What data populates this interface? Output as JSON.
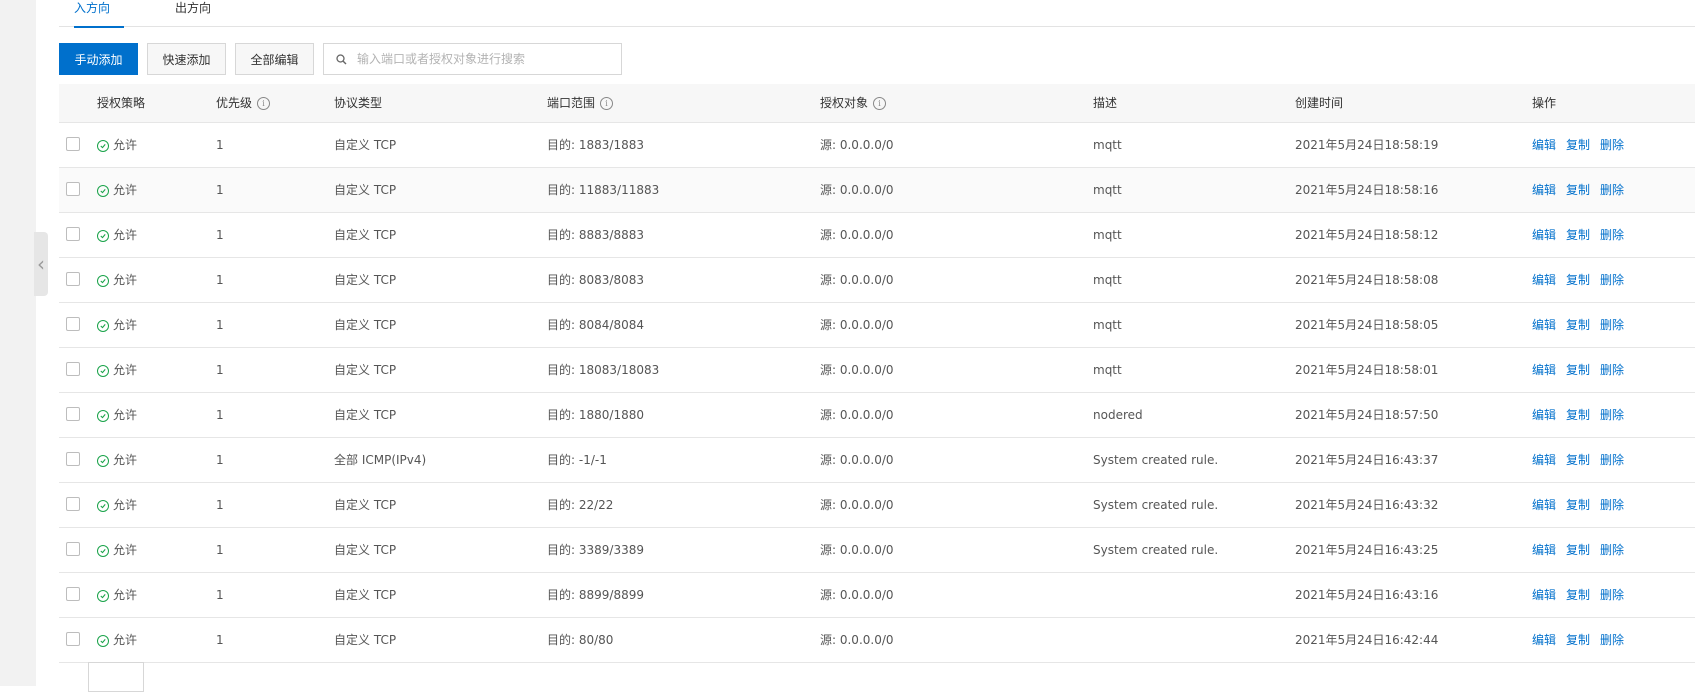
{
  "tabs": [
    {
      "label": "入方向",
      "active": true
    },
    {
      "label": "出方向",
      "active": false
    }
  ],
  "toolbar": {
    "manual_add": "手动添加",
    "quick_add": "快速添加",
    "edit_all": "全部编辑",
    "search_placeholder": "输入端口或者授权对象进行搜索"
  },
  "columns": {
    "policy": "授权策略",
    "priority": "优先级",
    "protocol": "协议类型",
    "port_range": "端口范围",
    "auth_object": "授权对象",
    "description": "描述",
    "created": "创建时间",
    "actions": "操作"
  },
  "actions": {
    "edit": "编辑",
    "copy": "复制",
    "delete": "删除"
  },
  "rows": [
    {
      "policy": "允许",
      "priority": "1",
      "protocol": "自定义 TCP",
      "port": "目的: 1883/1883",
      "source": "源: 0.0.0.0/0",
      "desc": "mqtt",
      "created": "2021年5月24日18:58:19"
    },
    {
      "policy": "允许",
      "priority": "1",
      "protocol": "自定义 TCP",
      "port": "目的: 11883/11883",
      "source": "源: 0.0.0.0/0",
      "desc": "mqtt",
      "created": "2021年5月24日18:58:16"
    },
    {
      "policy": "允许",
      "priority": "1",
      "protocol": "自定义 TCP",
      "port": "目的: 8883/8883",
      "source": "源: 0.0.0.0/0",
      "desc": "mqtt",
      "created": "2021年5月24日18:58:12"
    },
    {
      "policy": "允许",
      "priority": "1",
      "protocol": "自定义 TCP",
      "port": "目的: 8083/8083",
      "source": "源: 0.0.0.0/0",
      "desc": "mqtt",
      "created": "2021年5月24日18:58:08"
    },
    {
      "policy": "允许",
      "priority": "1",
      "protocol": "自定义 TCP",
      "port": "目的: 8084/8084",
      "source": "源: 0.0.0.0/0",
      "desc": "mqtt",
      "created": "2021年5月24日18:58:05"
    },
    {
      "policy": "允许",
      "priority": "1",
      "protocol": "自定义 TCP",
      "port": "目的: 18083/18083",
      "source": "源: 0.0.0.0/0",
      "desc": "mqtt",
      "created": "2021年5月24日18:58:01"
    },
    {
      "policy": "允许",
      "priority": "1",
      "protocol": "自定义 TCP",
      "port": "目的: 1880/1880",
      "source": "源: 0.0.0.0/0",
      "desc": "nodered",
      "created": "2021年5月24日18:57:50"
    },
    {
      "policy": "允许",
      "priority": "1",
      "protocol": "全部 ICMP(IPv4)",
      "port": "目的: -1/-1",
      "source": "源: 0.0.0.0/0",
      "desc": "System created rule.",
      "created": "2021年5月24日16:43:37"
    },
    {
      "policy": "允许",
      "priority": "1",
      "protocol": "自定义 TCP",
      "port": "目的: 22/22",
      "source": "源: 0.0.0.0/0",
      "desc": "System created rule.",
      "created": "2021年5月24日16:43:32"
    },
    {
      "policy": "允许",
      "priority": "1",
      "protocol": "自定义 TCP",
      "port": "目的: 3389/3389",
      "source": "源: 0.0.0.0/0",
      "desc": "System created rule.",
      "created": "2021年5月24日16:43:25"
    },
    {
      "policy": "允许",
      "priority": "1",
      "protocol": "自定义 TCP",
      "port": "目的: 8899/8899",
      "source": "源: 0.0.0.0/0",
      "desc": "",
      "created": "2021年5月24日16:43:16"
    },
    {
      "policy": "允许",
      "priority": "1",
      "protocol": "自定义 TCP",
      "port": "目的: 80/80",
      "source": "源: 0.0.0.0/0",
      "desc": "",
      "created": "2021年5月24日16:42:44"
    }
  ],
  "colors": {
    "accent": "#0070cc",
    "allow": "#1aa34a"
  }
}
